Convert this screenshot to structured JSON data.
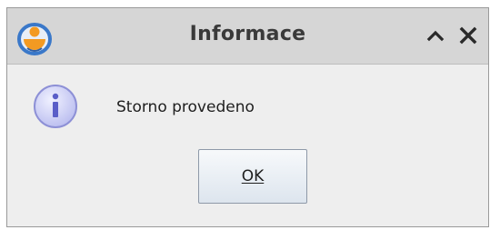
{
  "window": {
    "title": "Informace",
    "app_icon": "app-logo-icon",
    "controls": {
      "minimize_icon": "chevron-up-icon",
      "close_icon": "close-icon"
    }
  },
  "message": {
    "icon": "info-icon",
    "text": "Storno provedeno"
  },
  "buttons": {
    "ok_label": "OK"
  },
  "colors": {
    "titlebar": "#d6d6d6",
    "dialog_bg": "#eeeeee",
    "app_icon_blue": "#3a78c9",
    "app_icon_orange": "#f39a22",
    "info_icon_fill": "#c7c9f4",
    "info_icon_letter": "#5a5ec8"
  }
}
